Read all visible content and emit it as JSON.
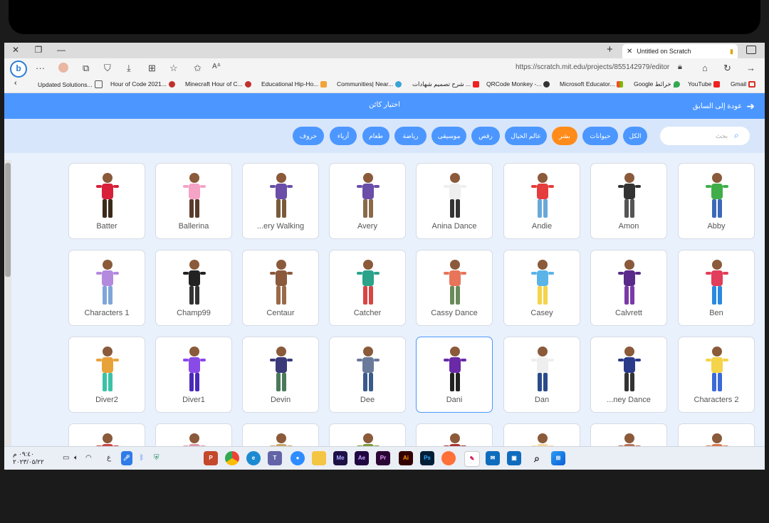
{
  "browser": {
    "tab_title": "Untitled on Scratch",
    "url": "https://scratch.mit.edu/projects/855142979/editor",
    "bookmarks": [
      "Updated Solutions...",
      "Hour of Code 2021...",
      "Minecraft Hour of C...",
      "Educational Hip-Ho...",
      "Communities| Near...",
      "شرح تصميم شهادات ...",
      "QRCode Monkey -...",
      "Microsoft Educator...",
      "Google خرائط",
      "YouTube",
      "Gmail"
    ]
  },
  "scratch": {
    "header_title": "اختيار كائن",
    "back_label": "عودة إلى السابق",
    "search_placeholder": "بحث",
    "categories": [
      "الكل",
      "حيوانات",
      "بشر",
      "عالم الخيال",
      "رقص",
      "موسيقى",
      "رياضة",
      "طعام",
      "أزياء",
      "حروف"
    ],
    "active_category": "بشر",
    "sprites": [
      {
        "name": "Batter"
      },
      {
        "name": "Ballerina"
      },
      {
        "name": "...ery Walking"
      },
      {
        "name": "Avery"
      },
      {
        "name": "Anina Dance"
      },
      {
        "name": "Andie"
      },
      {
        "name": "Amon"
      },
      {
        "name": "Abby"
      },
      {
        "name": "Characters 1"
      },
      {
        "name": "Champ99"
      },
      {
        "name": "Centaur"
      },
      {
        "name": "Catcher"
      },
      {
        "name": "Cassy Dance"
      },
      {
        "name": "Casey"
      },
      {
        "name": "Calvrett"
      },
      {
        "name": "Ben"
      },
      {
        "name": "Diver2"
      },
      {
        "name": "Diver1"
      },
      {
        "name": "Devin"
      },
      {
        "name": "Dee"
      },
      {
        "name": "Dani",
        "selected": true
      },
      {
        "name": "Dan"
      },
      {
        "name": "...ney Dance"
      },
      {
        "name": "Characters 2"
      },
      {
        "name": ""
      },
      {
        "name": ""
      },
      {
        "name": ""
      },
      {
        "name": ""
      },
      {
        "name": ""
      },
      {
        "name": ""
      },
      {
        "name": ""
      },
      {
        "name": ""
      }
    ]
  },
  "taskbar": {
    "time": "٠٩:٤٠ م",
    "date": "٢٠٢٣/٠٥/٢٢",
    "lang": "ع",
    "apps": [
      "PowerPoint",
      "Chrome",
      "Edge",
      "Teams",
      "Zoom",
      "File Explorer",
      "Me",
      "Ae",
      "Pr",
      "Ai",
      "Ps",
      "Firefox",
      "Paint",
      "Mail",
      "Store",
      "Search",
      "Start"
    ]
  },
  "colors": {
    "scratch_blue": "#4c97ff",
    "active_orange": "#ff8c1a",
    "filter_bg": "#d8e6fb",
    "content_bg": "#e9f1fc"
  }
}
